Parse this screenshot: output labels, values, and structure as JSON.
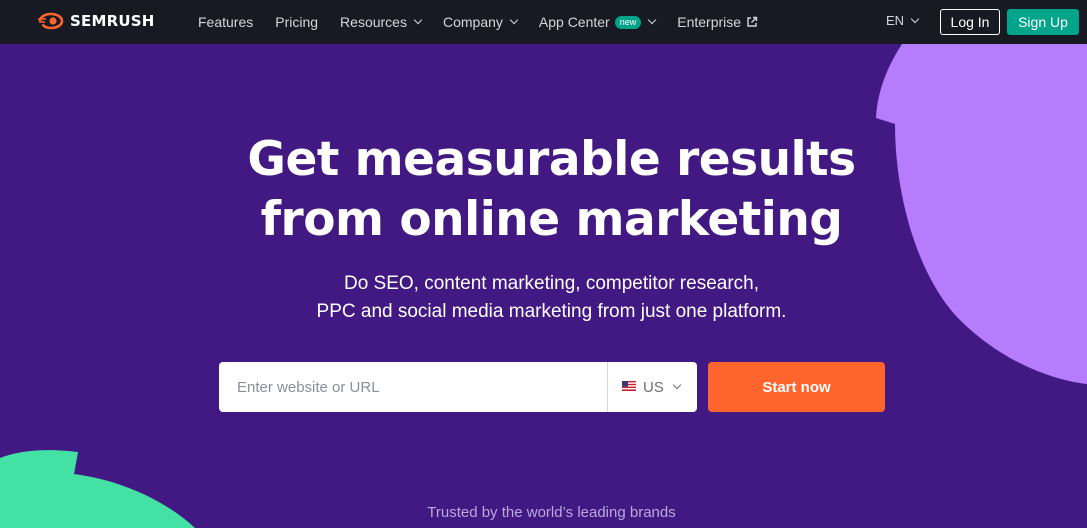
{
  "brand": {
    "name": "SEMRUSH"
  },
  "nav": {
    "items": [
      {
        "label": "Features",
        "has_dropdown": false
      },
      {
        "label": "Pricing",
        "has_dropdown": false
      },
      {
        "label": "Resources",
        "has_dropdown": true
      },
      {
        "label": "Company",
        "has_dropdown": true
      },
      {
        "label": "App Center",
        "has_dropdown": true,
        "badge": "new"
      },
      {
        "label": "Enterprise",
        "has_dropdown": false,
        "icon": "external-link-icon"
      }
    ],
    "language": "EN",
    "login_label": "Log In",
    "signup_label": "Sign Up"
  },
  "hero": {
    "title_line1": "Get measurable results",
    "title_line2": "from online marketing",
    "subtitle_line1": "Do SEO, content marketing, competitor research,",
    "subtitle_line2": "PPC and social media marketing from just one platform."
  },
  "search": {
    "placeholder": "Enter website or URL",
    "value": "",
    "database": "US",
    "database_icon": "us-flag-icon",
    "button_label": "Start now"
  },
  "footer_note": "Trusted by the world’s leading brands",
  "colors": {
    "nav_bg": "#171a22",
    "hero_bg": "#421983",
    "accent_orange": "#ff642d",
    "accent_green": "#00a48a",
    "shape_violet": "#b57cfb",
    "shape_green": "#44e1a5"
  }
}
